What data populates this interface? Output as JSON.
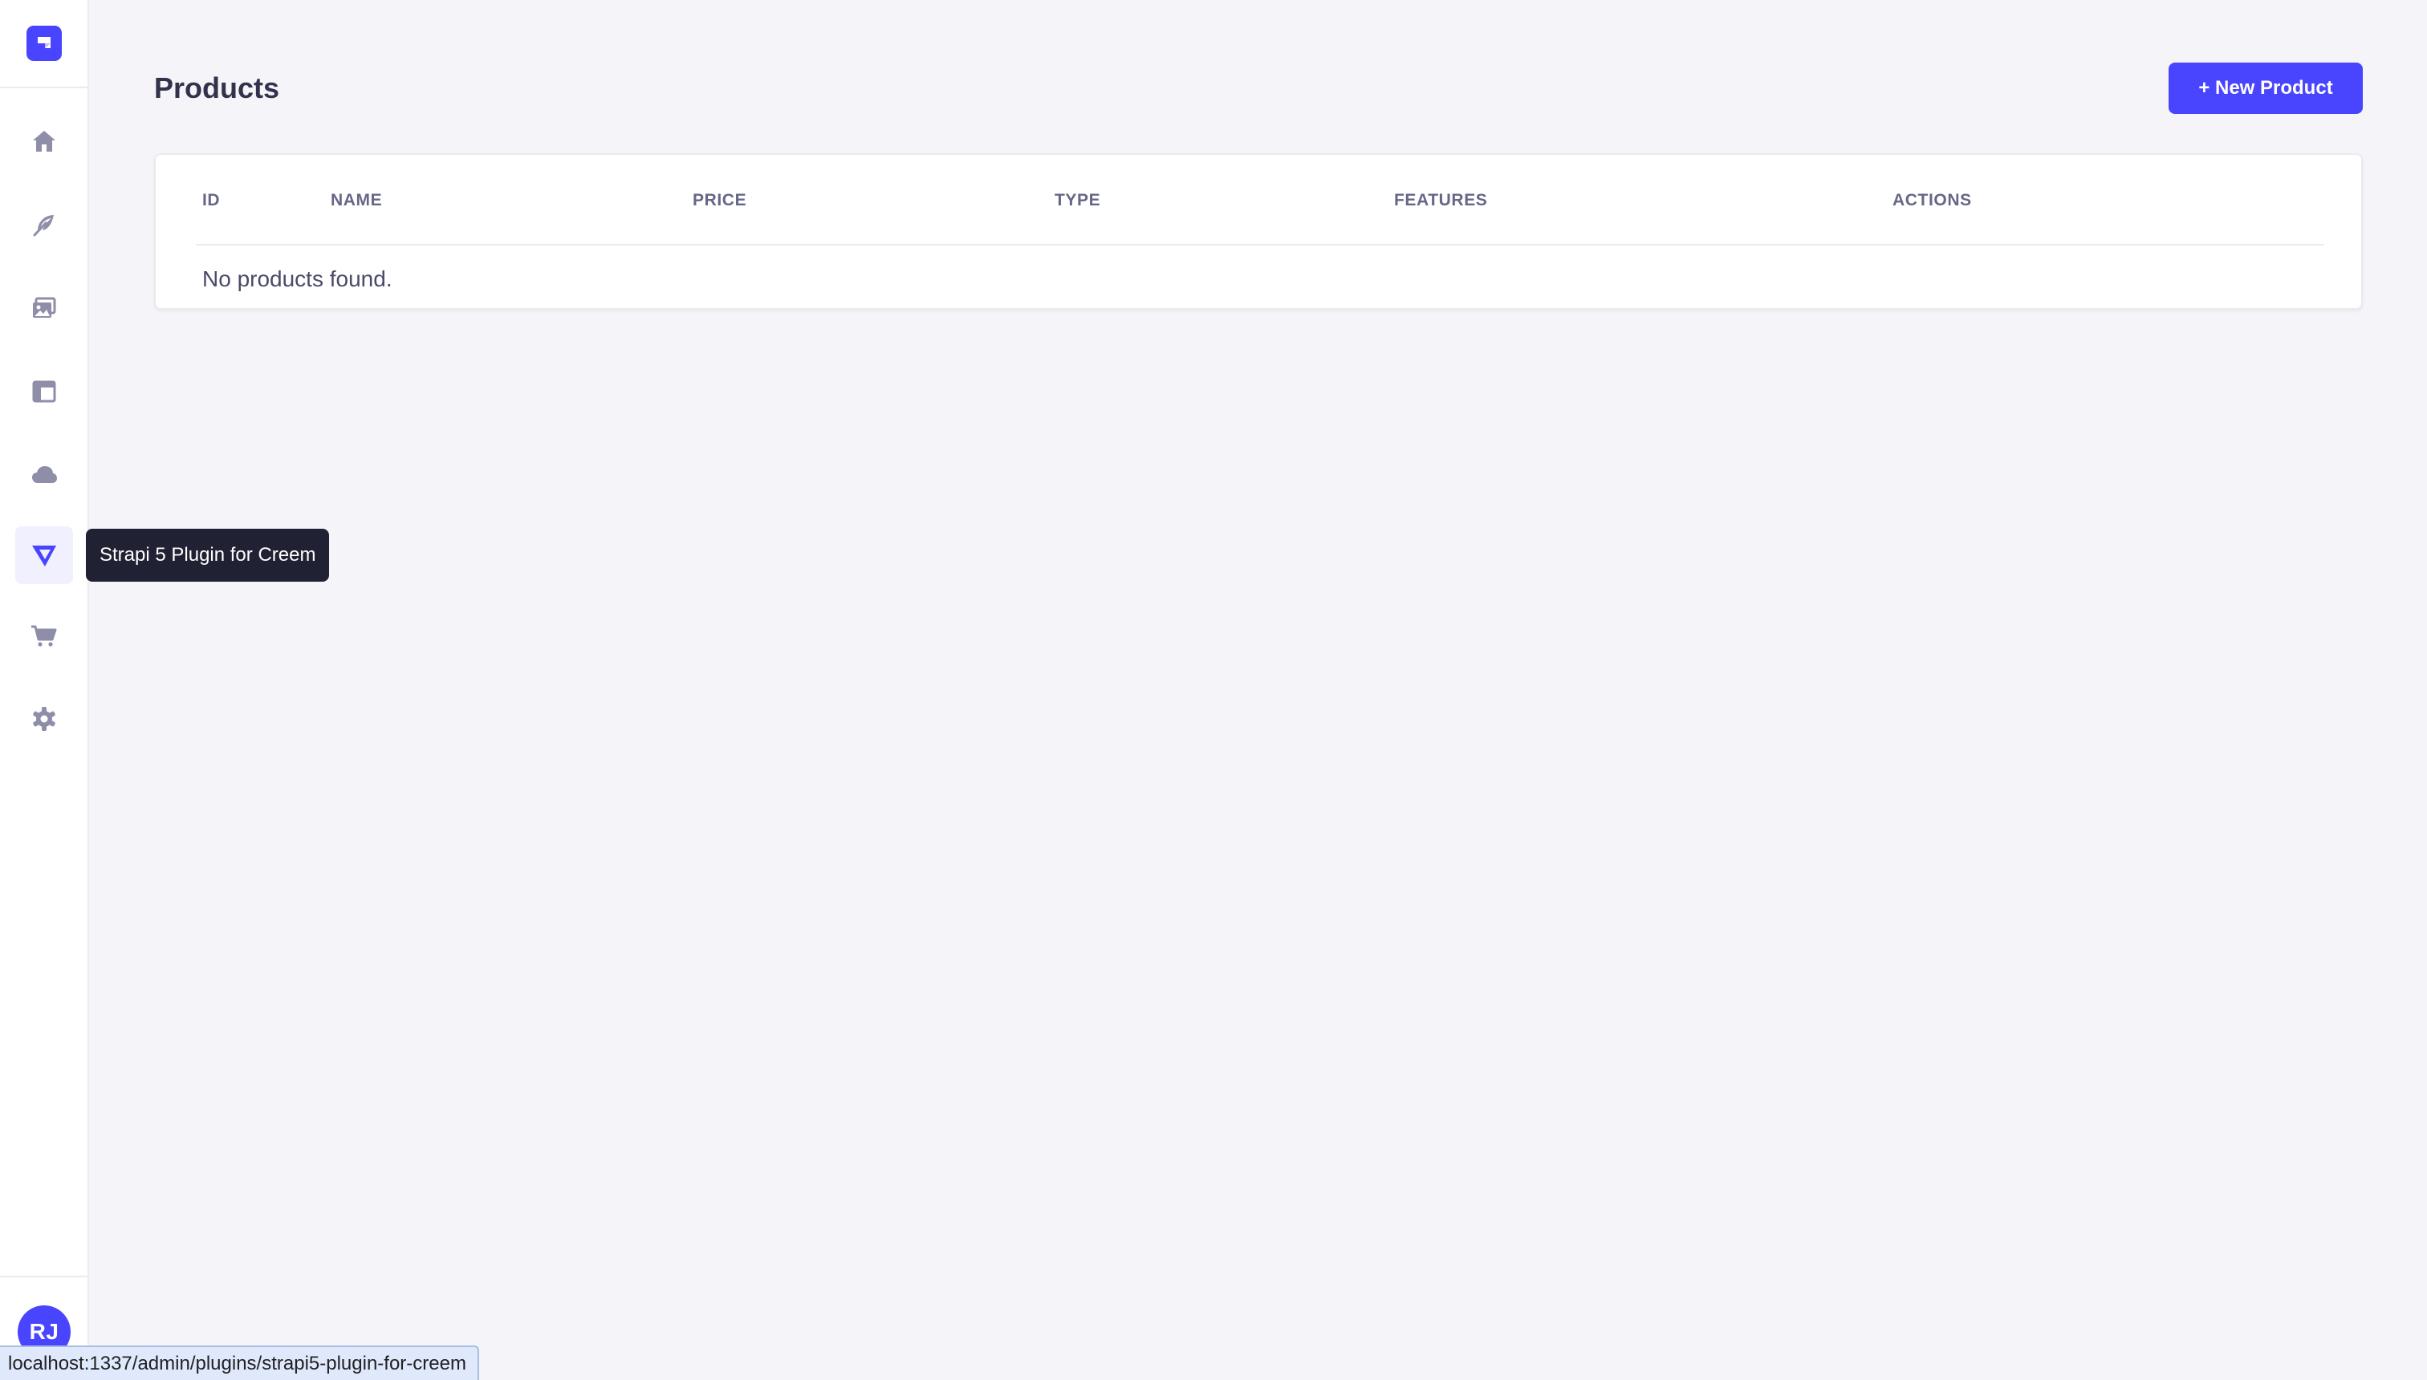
{
  "sidebar": {
    "avatar_initials": "RJ",
    "items": [
      {
        "name": "home",
        "icon": "home-icon"
      },
      {
        "name": "content-manager",
        "icon": "feather-icon"
      },
      {
        "name": "media-library",
        "icon": "images-icon"
      },
      {
        "name": "content-type-builder",
        "icon": "layout-icon"
      },
      {
        "name": "deploy",
        "icon": "cloud-icon"
      },
      {
        "name": "creem-plugin",
        "icon": "creem-logo-icon",
        "active": true
      },
      {
        "name": "marketplace",
        "icon": "cart-icon"
      },
      {
        "name": "settings",
        "icon": "gear-icon"
      }
    ]
  },
  "tooltip": {
    "text": "Strapi 5 Plugin for Creem"
  },
  "page": {
    "title": "Products",
    "new_button_label": "+ New Product"
  },
  "table": {
    "columns": [
      "ID",
      "NAME",
      "PRICE",
      "TYPE",
      "FEATURES",
      "ACTIONS"
    ],
    "empty_message": "No products found."
  },
  "statusbar": {
    "url": "localhost:1337/admin/plugins/strapi5-plugin-for-creem"
  },
  "colors": {
    "primary": "#4945ff",
    "icon": "#8e8ea9",
    "background": "#f5f5f9",
    "tooltip": "#212134"
  }
}
